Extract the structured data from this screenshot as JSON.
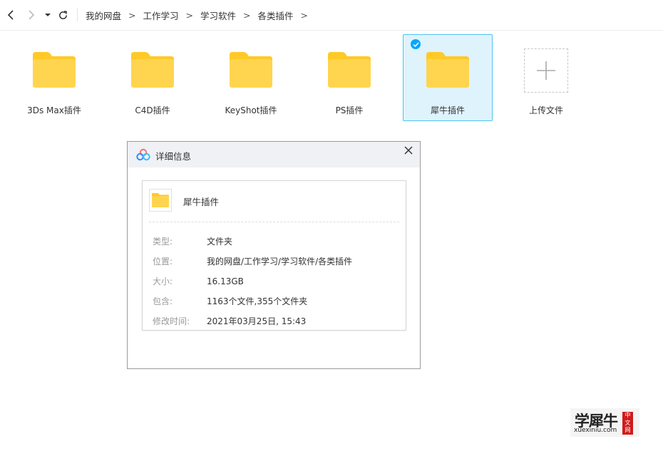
{
  "toolbar": {
    "breadcrumb": [
      "我的网盘",
      "工作学习",
      "学习软件",
      "各类插件"
    ],
    "separator": ">"
  },
  "files": [
    {
      "label": "3Ds Max插件",
      "type": "folder",
      "selected": false
    },
    {
      "label": "C4D插件",
      "type": "folder",
      "selected": false
    },
    {
      "label": "KeyShot插件",
      "type": "folder",
      "selected": false
    },
    {
      "label": "PS插件",
      "type": "folder",
      "selected": false
    },
    {
      "label": "犀牛插件",
      "type": "folder",
      "selected": true
    },
    {
      "label": "上传文件",
      "type": "upload",
      "selected": false
    }
  ],
  "dialog": {
    "title": "详细信息",
    "name": "犀牛插件",
    "rows": [
      {
        "label": "类型:",
        "value": "文件夹"
      },
      {
        "label": "位置:",
        "value": "我的网盘/工作学习/学习软件/各类插件"
      },
      {
        "label": "大小:",
        "value": "16.13GB"
      },
      {
        "label": "包含:",
        "value": "1163个文件,355个文件夹"
      },
      {
        "label": "修改时间:",
        "value": "2021年03月25日, 15:43"
      }
    ]
  },
  "watermark": {
    "main": "学犀牛",
    "sub": "xuexiniu.com",
    "badge": [
      "中",
      "文",
      "网"
    ]
  },
  "colors": {
    "folder": "#ffd54f",
    "folder_tab": "#ffc928",
    "selected_bg": "#dff3fd",
    "selected_border": "#4fc3ef",
    "check": "#06a7ff"
  }
}
